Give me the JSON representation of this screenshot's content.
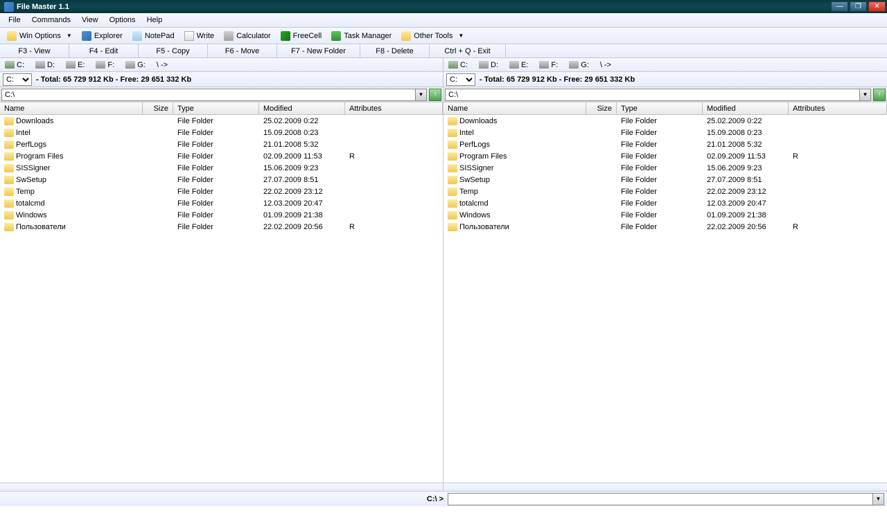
{
  "title": "File Master 1.1",
  "menu": {
    "file": "File",
    "commands": "Commands",
    "view": "View",
    "options": "Options",
    "help": "Help"
  },
  "toolbar": {
    "winOptions": "Win Options",
    "explorer": "Explorer",
    "notepad": "NotePad",
    "write": "Write",
    "calculator": "Calculator",
    "freecell": "FreeCell",
    "taskmgr": "Task Manager",
    "otherTools": "Other Tools"
  },
  "fkeys": {
    "f3": "F3 - View",
    "f4": "F4 - Edit",
    "f5": "F5 - Copy",
    "f6": "F6 - Move",
    "f7": "F7 - New Folder",
    "f8": "F8 - Delete",
    "quit": "Ctrl + Q - Exit"
  },
  "drives": {
    "c": "C:",
    "d": "D:",
    "e": "E:",
    "f": "F:",
    "g": "G:",
    "root": "\\ ->"
  },
  "panelLeft": {
    "selected": "C:",
    "info": "- Total: 65 729 912 Kb - Free: 29 651 332 Kb",
    "path": "C:\\"
  },
  "panelRight": {
    "selected": "C:",
    "info": "- Total: 65 729 912 Kb - Free: 29 651 332 Kb",
    "path": "C:\\"
  },
  "cols": {
    "name": "Name",
    "size": "Size",
    "type": "Type",
    "mod": "Modified",
    "attr": "Attributes"
  },
  "files": [
    {
      "name": "Downloads",
      "type": "File Folder",
      "mod": "25.02.2009 0:22",
      "attr": ""
    },
    {
      "name": "Intel",
      "type": "File Folder",
      "mod": "15.09.2008 0:23",
      "attr": ""
    },
    {
      "name": "PerfLogs",
      "type": "File Folder",
      "mod": "21.01.2008 5:32",
      "attr": ""
    },
    {
      "name": "Program Files",
      "type": "File Folder",
      "mod": "02.09.2009 11:53",
      "attr": "R"
    },
    {
      "name": "SISSigner",
      "type": "File Folder",
      "mod": "15.06.2009 9:23",
      "attr": ""
    },
    {
      "name": "SwSetup",
      "type": "File Folder",
      "mod": "27.07.2009 8:51",
      "attr": ""
    },
    {
      "name": "Temp",
      "type": "File Folder",
      "mod": "22.02.2009 23:12",
      "attr": ""
    },
    {
      "name": "totalcmd",
      "type": "File Folder",
      "mod": "12.03.2009 20:47",
      "attr": ""
    },
    {
      "name": "Windows",
      "type": "File Folder",
      "mod": "01.09.2009 21:38",
      "attr": ""
    },
    {
      "name": "Пользователи",
      "type": "File Folder",
      "mod": "22.02.2009 20:56",
      "attr": "R"
    }
  ],
  "cmdPrompt": "C:\\ >"
}
